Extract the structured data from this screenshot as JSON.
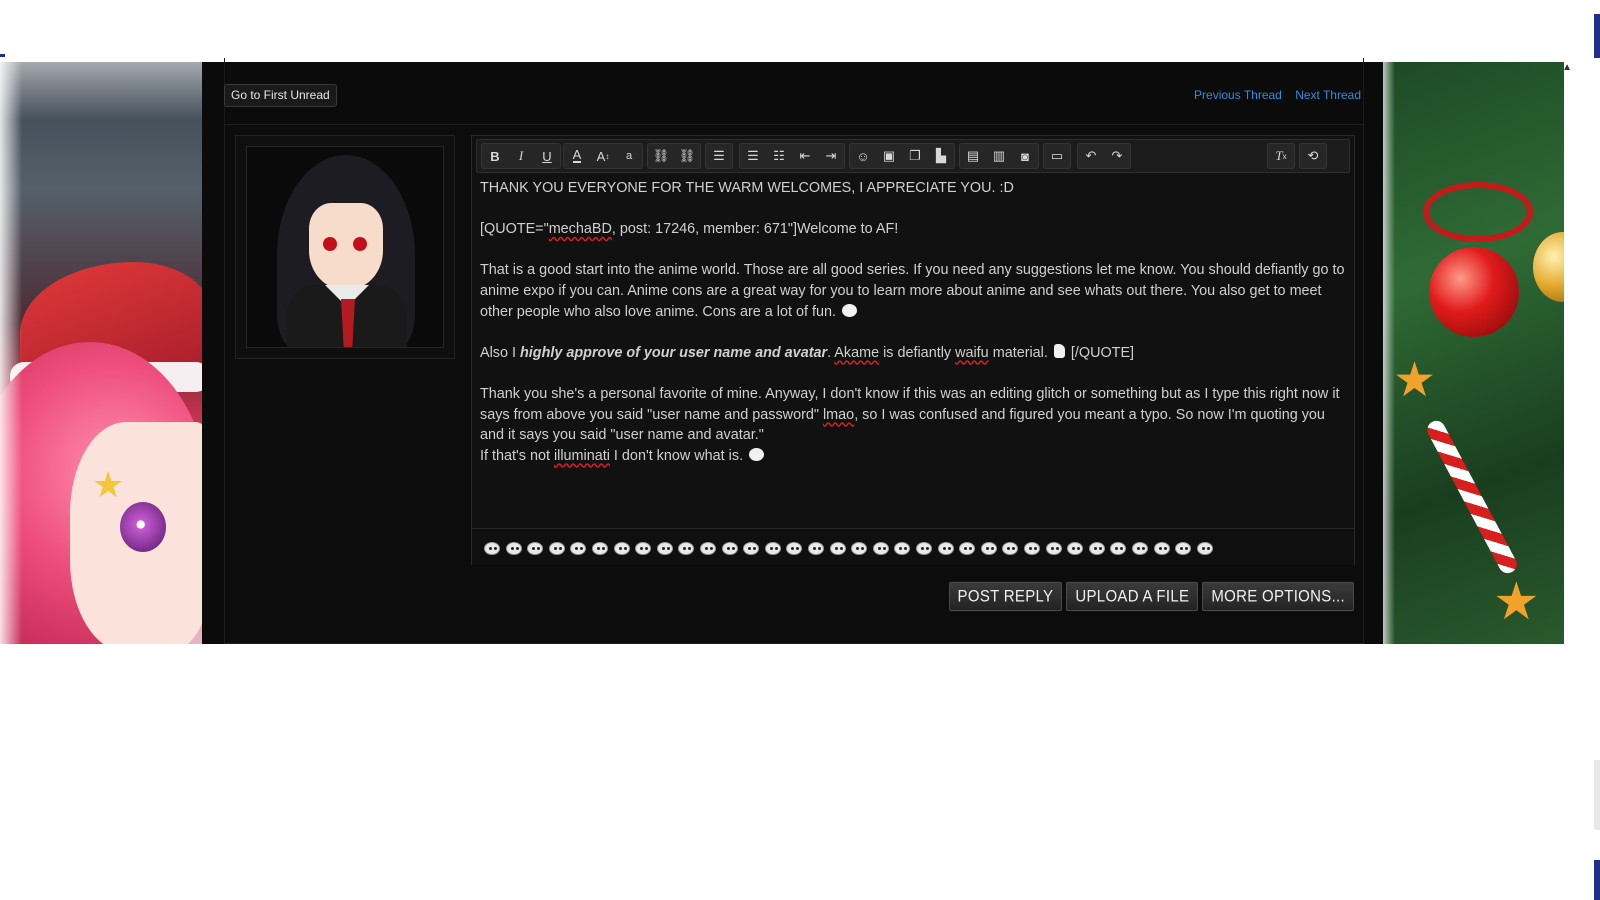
{
  "thread": {
    "first_unread_label": "Go to First Unread",
    "previous_label": "Previous Thread",
    "next_label": "Next Thread"
  },
  "colors": {
    "page_bg": "#0b0b0b",
    "link": "#2f8ddb",
    "text": "#d0d0d0"
  },
  "toolbar": {
    "icons": [
      "bold-icon",
      "italic-icon",
      "underline-icon",
      "text-color-icon",
      "font-size-icon",
      "font-family-icon",
      "link-icon",
      "unlink-icon",
      "align-icon",
      "bullet-list-icon",
      "numbered-list-icon",
      "outdent-icon",
      "indent-icon",
      "smilie-icon",
      "image-icon",
      "media-icon",
      "insert-icon",
      "quote-icon",
      "code-icon",
      "screenshot-icon",
      "save-draft-icon",
      "undo-icon",
      "redo-icon",
      "remove-formatting-icon",
      "toggle-bbcode-icon"
    ]
  },
  "editor": {
    "line1": "THANK YOU EVERYONE FOR THE WARM WELCOMES, I APPRECIATE YOU. :D",
    "quote_open_a": "[QUOTE=\"",
    "quote_user": "mechaBD",
    "quote_open_b": ", post: 17246, member: 671\"]Welcome to AF!",
    "para2": "That is a good start into the anime world. Those are all good series. If you need any suggestions let me know. You should defiantly go to anime expo if you can. Anime cons are a great way for you to learn more about anime and see whats out there. You also get to meet other people who also love anime. Cons are a lot of fun.",
    "para3_a": "Also I ",
    "para3_bold": "highly approve of your user name and avatar",
    "para3_b": ". ",
    "para3_akame": "Akame",
    "para3_c": " is defiantly ",
    "para3_waifu": "waifu",
    "para3_d": " material.",
    "para3_close": "[/QUOTE]",
    "para4_a": "Thank you she's a personal favorite of mine. Anyway, I don't know if this was an editing glitch or something but as I type this right now it says from above you said \"user name and password\" ",
    "para4_lmao": "lmao",
    "para4_b": ", so I was confused and figured you meant a typo. So now I'm quoting you and it says you said \"user name and avatar.\"",
    "para5_a": "If that's not ",
    "para5_illuminati": "illuminati",
    "para5_b": " I don't know what is."
  },
  "buttons": {
    "post_reply": "POST REPLY",
    "upload_file": "UPLOAD A FILE",
    "more_options": "MORE OPTIONS..."
  }
}
